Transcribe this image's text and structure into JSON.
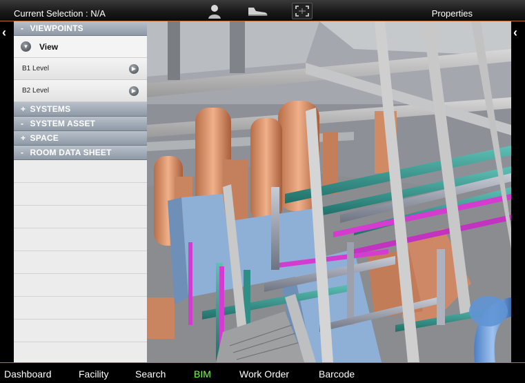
{
  "header": {
    "selection_label": "Current Selection : N/A",
    "properties_label": "Properties"
  },
  "tools": {
    "person_icon": "person-icon",
    "shoe_icon": "walk-shoe-icon",
    "frame_icon": "fit-view-icon"
  },
  "panel": {
    "viewpoints": {
      "sign": "-",
      "label": "VIEWPOINTS"
    },
    "view_row": {
      "label": "View"
    },
    "levels": [
      {
        "label": "B1 Level"
      },
      {
        "label": "B2 Level"
      }
    ],
    "sections": [
      {
        "sign": "+",
        "label": "SYSTEMS"
      },
      {
        "sign": "-",
        "label": "SYSTEM ASSET"
      },
      {
        "sign": "+",
        "label": "SPACE"
      },
      {
        "sign": "-",
        "label": "ROOM DATA SHEET"
      }
    ]
  },
  "nav": {
    "items": [
      "Dashboard",
      "Facility",
      "Search",
      "BIM",
      "Work Order",
      "Barcode"
    ],
    "active": "BIM"
  },
  "colors": {
    "accent": "#c96a2a",
    "active_nav": "#7dff4a",
    "pipe_teal": "#2f8f86",
    "pipe_magenta": "#d43cd0",
    "equipment": "#d9906a",
    "duct_blue": "#8fb0d6"
  }
}
